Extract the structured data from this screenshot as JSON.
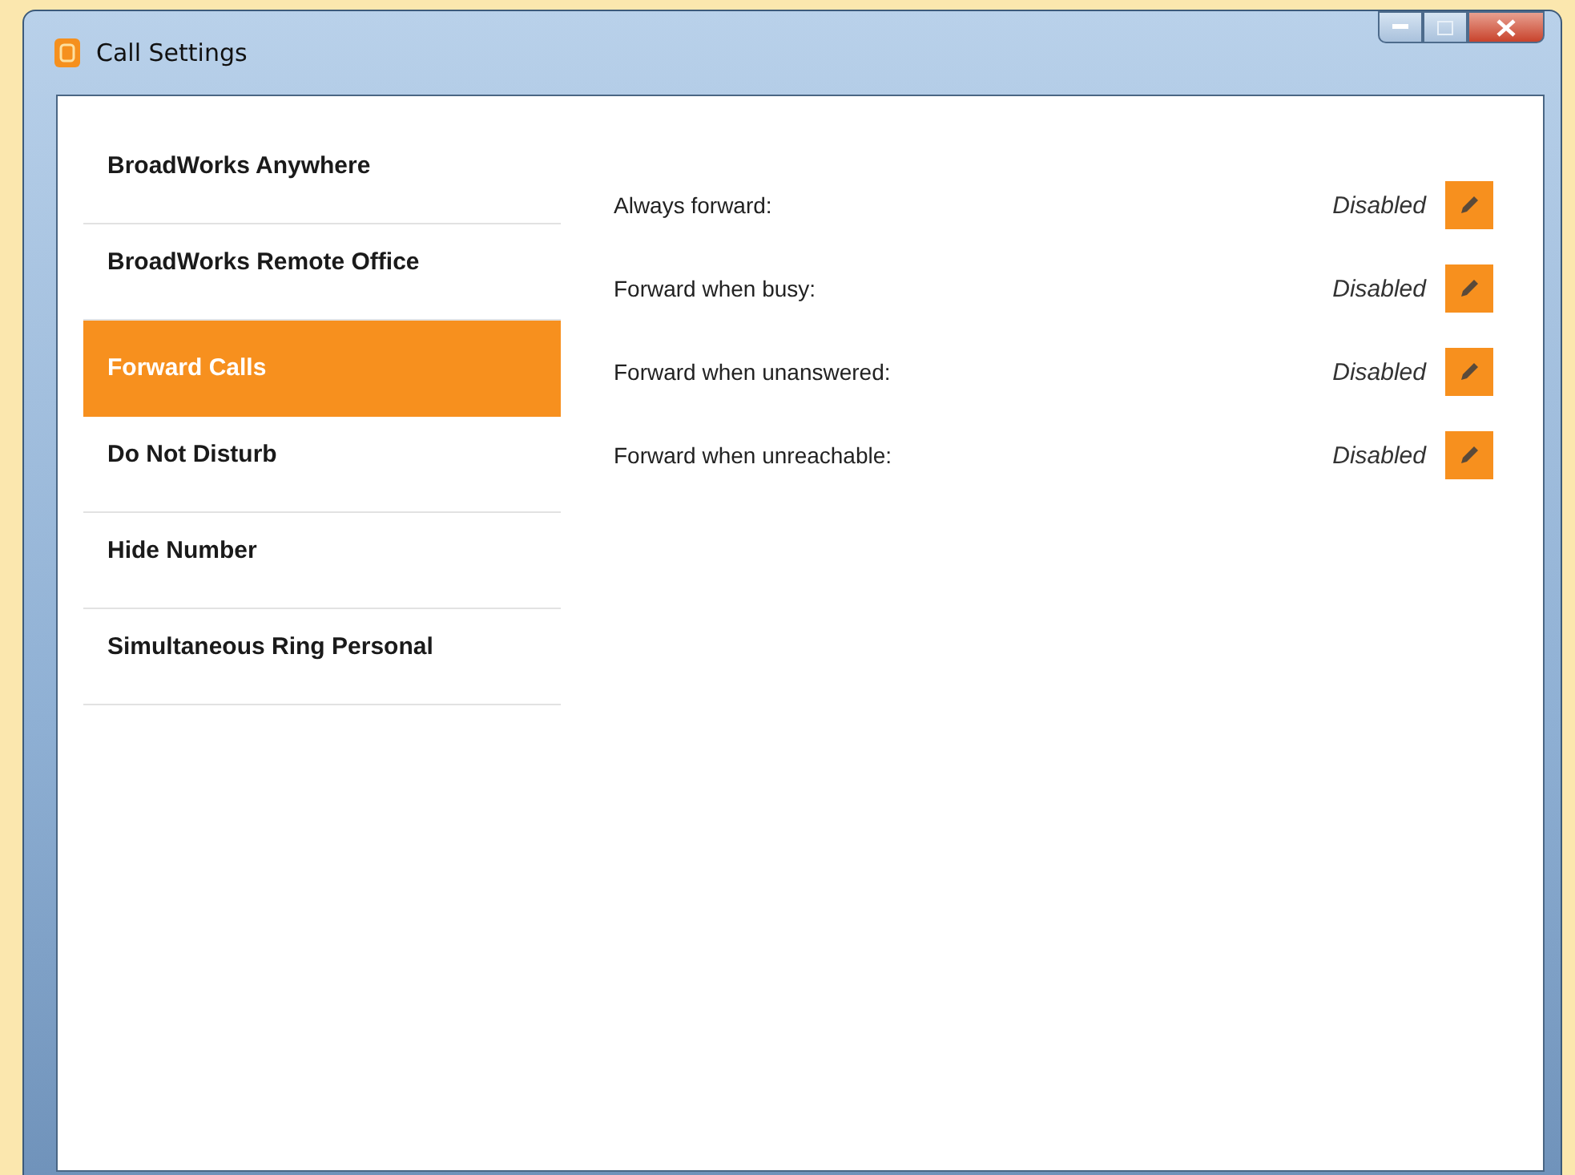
{
  "window": {
    "title": "Call Settings"
  },
  "sidebar": {
    "items": [
      {
        "label": "BroadWorks Anywhere",
        "selected": false
      },
      {
        "label": "BroadWorks Remote Office",
        "selected": false
      },
      {
        "label": "Forward Calls",
        "selected": true
      },
      {
        "label": "Do Not Disturb",
        "selected": false
      },
      {
        "label": "Hide Number",
        "selected": false
      },
      {
        "label": "Simultaneous Ring Personal",
        "selected": false
      }
    ]
  },
  "settings": [
    {
      "label": "Always forward:",
      "status": "Disabled"
    },
    {
      "label": "Forward when busy:",
      "status": "Disabled"
    },
    {
      "label": "Forward when unanswered:",
      "status": "Disabled"
    },
    {
      "label": "Forward when unreachable:",
      "status": "Disabled"
    }
  ]
}
